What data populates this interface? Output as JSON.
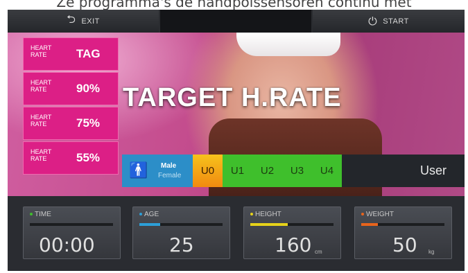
{
  "caption": "Ze programma's de handpolssensoren continu met",
  "topbar": {
    "exit_label": "EXIT",
    "start_label": "START",
    "exit_icon": "back-arrow-icon",
    "start_icon": "power-icon"
  },
  "hero": {
    "title": "TARGET H.RATE"
  },
  "heart_rate_buttons": [
    {
      "line1": "HEART",
      "line2": "RATE",
      "value": "TAG"
    },
    {
      "line1": "HEART",
      "line2": "RATE",
      "value": "90%"
    },
    {
      "line1": "HEART",
      "line2": "RATE",
      "value": "75%"
    },
    {
      "line1": "HEART",
      "line2": "RATE",
      "value": "55%"
    }
  ],
  "profile": {
    "gender": {
      "male": "Male",
      "female": "Female",
      "icon": "person-icon"
    },
    "users": [
      "U0",
      "U1",
      "U2",
      "U3",
      "U4"
    ],
    "user_label": "User"
  },
  "stats": [
    {
      "label": "TIME",
      "value": "00:00",
      "unit": "",
      "accent": "#3fbf2c",
      "bar_fill": 0.0
    },
    {
      "label": "AGE",
      "value": "25",
      "unit": "",
      "accent": "#2c9fd8",
      "bar_fill": 0.25
    },
    {
      "label": "HEIGHT",
      "value": "160",
      "unit": "cm",
      "accent": "#e6d21a",
      "bar_fill": 0.45
    },
    {
      "label": "WEIGHT",
      "value": "50",
      "unit": "kg",
      "accent": "#e8641c",
      "bar_fill": 0.2
    }
  ],
  "colors": {
    "heart_rate": "#dc1f86",
    "gender": "#2c8ec8",
    "user_selected": "#f6c21c",
    "user": "#3fbf2c"
  }
}
